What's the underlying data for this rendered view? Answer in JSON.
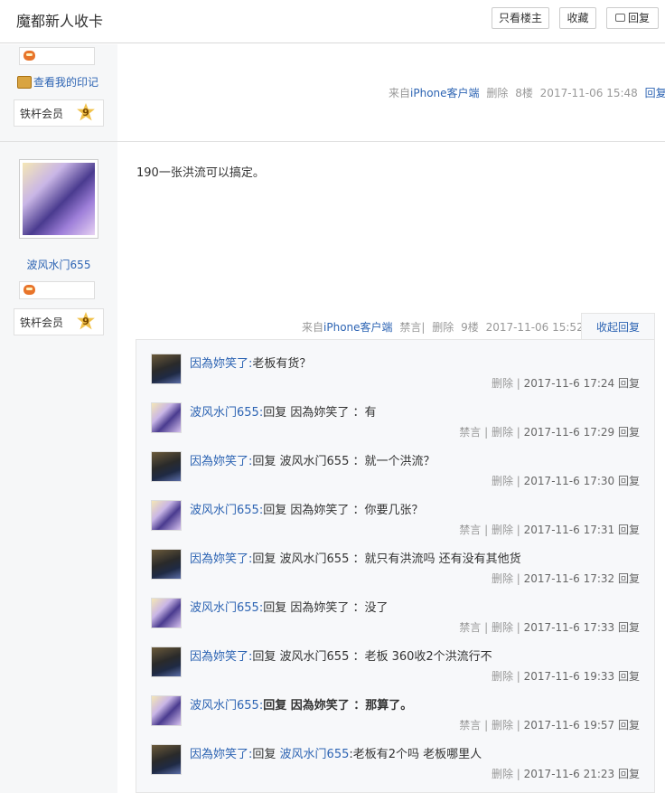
{
  "header": {
    "title": "魔都新人收卡",
    "buttons": {
      "only_op": "只看楼主",
      "favorite": "收藏",
      "reply": "回复"
    }
  },
  "floor8": {
    "imprint_label": "查看我的印记",
    "member_label": "铁杆会员",
    "member_level": "9",
    "meta": {
      "from": "来自",
      "client": "iPhone客户端",
      "delete": "删除",
      "floor": "8楼",
      "time": "2017-11-06 15:48",
      "reply": "回复"
    }
  },
  "floor9": {
    "username": "波风水门655",
    "member_label": "铁杆会员",
    "member_level": "9",
    "content": "190一张洪流可以搞定。",
    "meta": {
      "from": "来自",
      "client": "iPhone客户端",
      "ban": "禁言",
      "sep": "|",
      "delete": "删除",
      "floor": "9楼",
      "time": "2017-11-06 15:52"
    },
    "collapse_label": "收起回复"
  },
  "replies": [
    {
      "avatar": "a",
      "user": "因為妳笑了:",
      "text": "老板有货？",
      "actions": "删除 |",
      "time": "2017-11-6 17:24",
      "reply": "回复",
      "bold": false
    },
    {
      "avatar": "b",
      "user": "波风水门655:",
      "text": "回复 因為妳笑了 ：有",
      "actions": "禁言 | 删除 |",
      "time": "2017-11-6 17:29",
      "reply": "回复",
      "bold": false
    },
    {
      "avatar": "a",
      "user": "因為妳笑了:",
      "text": "回复 波风水门655 ：就一个洪流？",
      "actions": "删除 |",
      "time": "2017-11-6 17:30",
      "reply": "回复",
      "bold": false
    },
    {
      "avatar": "b",
      "user": "波风水门655:",
      "text": "回复 因為妳笑了 ：你要几张？",
      "actions": "禁言 | 删除 |",
      "time": "2017-11-6 17:31",
      "reply": "回复",
      "bold": false
    },
    {
      "avatar": "a",
      "user": "因為妳笑了:",
      "text": "回复 波风水门655 ：就只有洪流吗 还有没有其他货",
      "actions": "删除 |",
      "time": "2017-11-6 17:32",
      "reply": "回复",
      "bold": false
    },
    {
      "avatar": "b",
      "user": "波风水门655:",
      "text": "回复 因為妳笑了 ：没了",
      "actions": "禁言 | 删除 |",
      "time": "2017-11-6 17:33",
      "reply": "回复",
      "bold": false
    },
    {
      "avatar": "a",
      "user": "因為妳笑了:",
      "text": "回复 波风水门655 ：老板 360收2个洪流行不",
      "actions": "删除 |",
      "time": "2017-11-6 19:33",
      "reply": "回复",
      "bold": false
    },
    {
      "avatar": "b",
      "user": "波风水门655:",
      "text": "回复 因為妳笑了 ：那算了。",
      "actions": "禁言 | 删除 |",
      "time": "2017-11-6 19:57",
      "reply": "回复",
      "bold": true
    },
    {
      "avatar": "a",
      "user": "因為妳笑了:",
      "pre": "回复",
      "mention": "波风水门655",
      "text": ":老板有2个吗 老板哪里人",
      "actions": "删除 |",
      "time": "2017-11-6 21:23",
      "reply": "回复",
      "bold": false
    }
  ]
}
